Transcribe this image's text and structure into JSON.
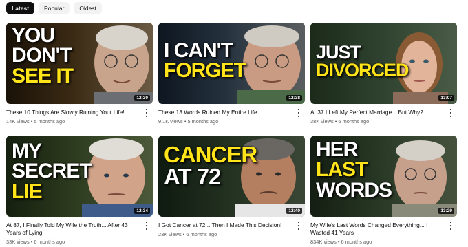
{
  "filters": [
    {
      "label": "Latest",
      "active": true
    },
    {
      "label": "Popular",
      "active": false
    },
    {
      "label": "Oldest",
      "active": false
    }
  ],
  "videos": [
    {
      "thumb_lines": [
        {
          "text": "YOU",
          "color": "white"
        },
        {
          "text": "DON'T",
          "color": "white"
        },
        {
          "text": "SEE IT",
          "color": "yellow"
        }
      ],
      "duration": "12:30",
      "title": "These 10 Things Are Slowly Ruining Your Life!",
      "views": "14K views",
      "age": "5 months ago"
    },
    {
      "thumb_lines": [
        {
          "text": "I CAN'T",
          "color": "white"
        },
        {
          "text": "FORGET",
          "color": "yellow"
        }
      ],
      "duration": "12:38",
      "title": "These 13 Words Ruined My Entire Life.",
      "views": "9.1K views",
      "age": "5 months ago"
    },
    {
      "thumb_lines": [
        {
          "text": "JUST",
          "color": "white"
        },
        {
          "text": "DIVORCED",
          "color": "yellow"
        }
      ],
      "duration": "13:07",
      "title": "At 37 I Left My Perfect Marriage... But Why?",
      "views": "38K views",
      "age": "6 months ago"
    },
    {
      "thumb_lines": [
        {
          "text": "MY",
          "color": "white"
        },
        {
          "text": "SECRET",
          "color": "white"
        },
        {
          "text": "LIE",
          "color": "yellow"
        }
      ],
      "duration": "12:34",
      "title": "At 87, I Finally Told My Wife the Truth... After 43 Years of Lying",
      "views": "33K views",
      "age": "6 months ago"
    },
    {
      "thumb_lines": [
        {
          "text": "CANCER",
          "color": "yellow"
        },
        {
          "text": "AT 72",
          "color": "white"
        }
      ],
      "duration": "12:40",
      "title": "I Got Cancer at 72... Then I Made This Decision!",
      "views": "23K views",
      "age": "6 months ago"
    },
    {
      "thumb_lines": [
        {
          "text": "HER",
          "color": "white"
        },
        {
          "text": "LAST",
          "color": "yellow"
        },
        {
          "text": "WORDS",
          "color": "white"
        }
      ],
      "duration": "13:29",
      "title": "My Wife's Last Words Changed Everything... I Wasted 41 Years",
      "views": "834K views",
      "age": "6 months ago"
    }
  ],
  "separator": "•",
  "icons": {
    "more": "three-dots-vertical-icon"
  },
  "colors": {
    "yellow": "#ffe41a",
    "white": "#ffffff",
    "chip_active": "#0f0f0f",
    "chip": "#f2f2f2"
  }
}
